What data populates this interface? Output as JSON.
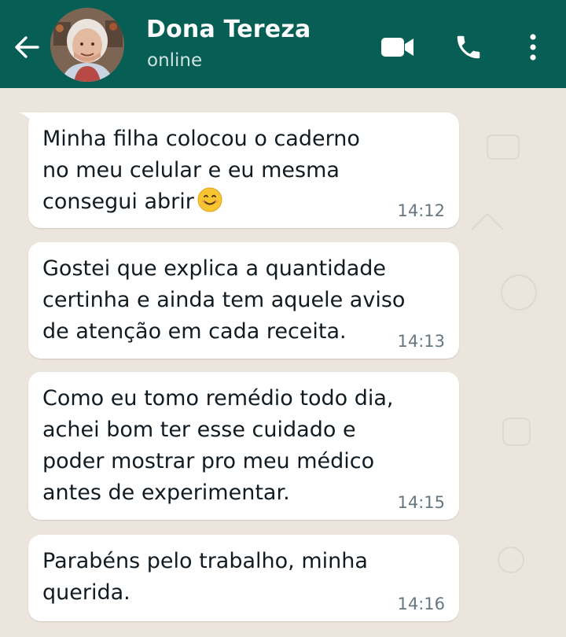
{
  "header": {
    "contact_name": "Dona Tereza",
    "contact_status": "online",
    "icons": [
      "back-arrow-icon",
      "video-call-icon",
      "phone-icon",
      "more-menu-icon"
    ]
  },
  "messages": [
    {
      "text": "Minha filha colocou o caderno\nno meu celular e eu mesma\nconsegui abrir",
      "emoji": "smiling-face-emoji",
      "time": "14:12"
    },
    {
      "text": "Gostei que explica a quantidade\ncertinha e ainda tem aquele aviso\nde atenção em cada receita.",
      "time": "14:13"
    },
    {
      "text": "Como eu tomo remédio todo dia,\nachei bom ter esse cuidado e\npoder mostrar pro meu médico\nantes de experimentar.",
      "time": "14:15"
    },
    {
      "text": "Parabéns pelo trabalho, minha\nquerida.",
      "time": "14:16"
    }
  ],
  "colors": {
    "header_bg": "#075e54",
    "chat_bg": "#ece5dd",
    "bubble_bg": "#ffffff",
    "time_text": "#667781"
  }
}
